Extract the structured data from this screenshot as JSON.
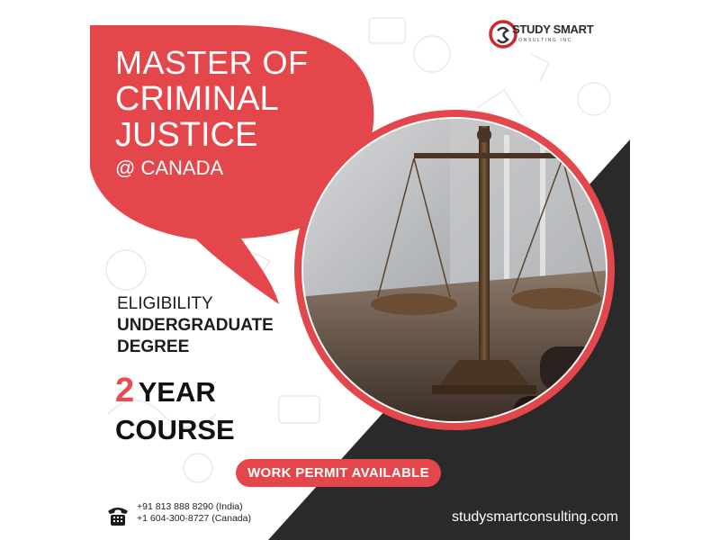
{
  "logo": {
    "name": "STUDY SMART",
    "sub": "CONSULTING INC."
  },
  "title": {
    "line1": "MASTER OF",
    "line2": "CRIMINAL",
    "line3": "JUSTICE",
    "line4": "@ CANADA"
  },
  "eligibility": {
    "label": "ELIGIBILITY",
    "line1": "UNDERGRADUATE",
    "line2": "DEGREE"
  },
  "course": {
    "number": "2",
    "word1": "YEAR",
    "word2": "COURSE"
  },
  "work_permit_label": "WORK PERMIT AVAILABLE",
  "contact": {
    "phone_india": "+91 813 888 8290 (India)",
    "phone_canada": "+1 604-300-8727 (Canada)"
  },
  "website": "studysmartconsulting.com",
  "colors": {
    "accent": "#e4474b",
    "dark": "#2a2a2a"
  },
  "icons": [
    "logo-mark-icon",
    "phone-icon"
  ]
}
